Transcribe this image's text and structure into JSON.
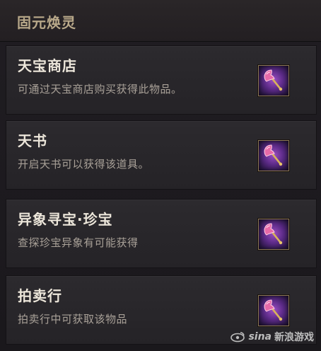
{
  "header": {
    "title": "固元焕灵"
  },
  "sources": [
    {
      "title": "天宝商店",
      "description": "可通过天宝商店购买获得此物品。",
      "icon": "purple-axe-icon"
    },
    {
      "title": "天书",
      "description": "开启天书可以获得该道具。",
      "icon": "purple-axe-icon"
    },
    {
      "title": "异象寻宝·珍宝",
      "description": "查探珍宝异象有可能获得",
      "icon": "purple-axe-icon"
    },
    {
      "title": "拍卖行",
      "description": "拍卖行中可获取该物品",
      "icon": "purple-axe-icon"
    }
  ],
  "watermark": {
    "brand": "sina",
    "text": "新浪游戏"
  },
  "colors": {
    "background": "#1a181c",
    "header_text": "#b9a98a",
    "title_text": "#ece6da",
    "desc_text": "#a9a198",
    "icon_purple": "#5b2a86",
    "icon_frame": "#8a7754"
  }
}
